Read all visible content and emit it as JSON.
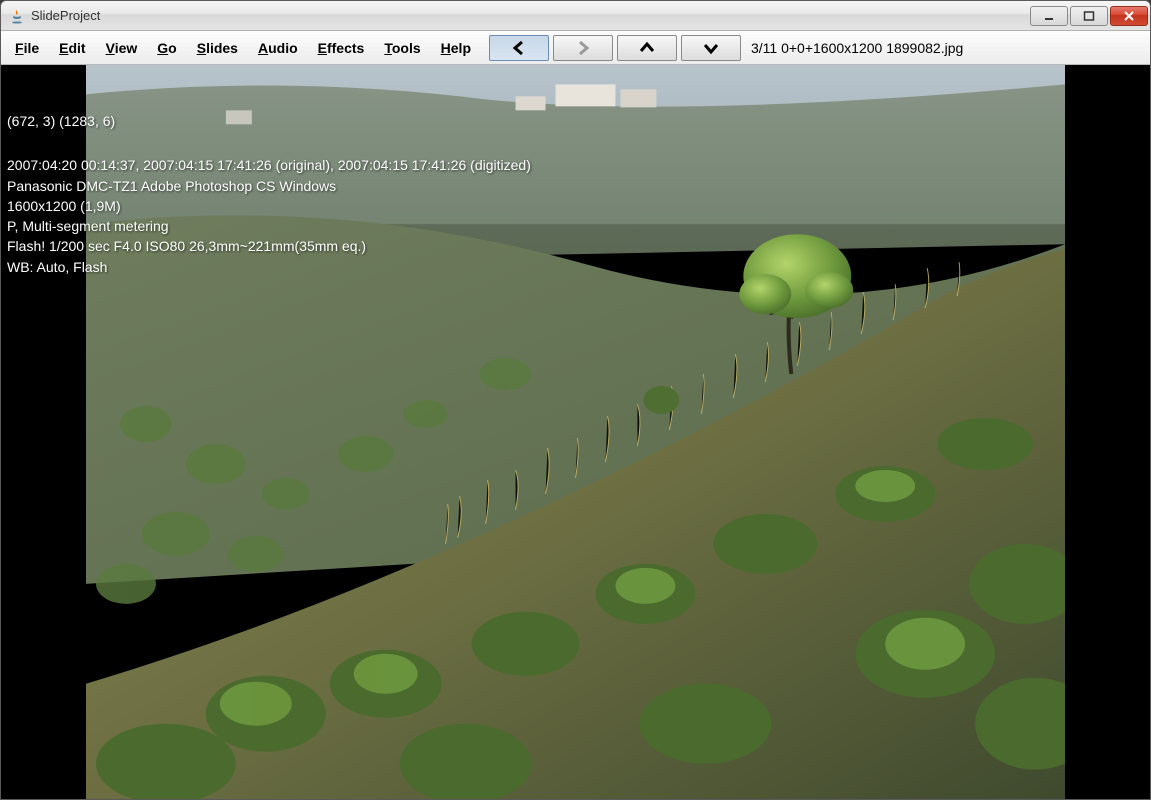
{
  "window": {
    "title": "SlideProject"
  },
  "menu": {
    "items": [
      {
        "label": "File",
        "ul": "F"
      },
      {
        "label": "Edit",
        "ul": "E"
      },
      {
        "label": "View",
        "ul": "V"
      },
      {
        "label": "Go",
        "ul": "G"
      },
      {
        "label": "Slides",
        "ul": "S"
      },
      {
        "label": "Audio",
        "ul": "A"
      },
      {
        "label": "Effects",
        "ul": "E"
      },
      {
        "label": "Tools",
        "ul": "T"
      },
      {
        "label": "Help",
        "ul": "H"
      }
    ]
  },
  "toolbar": {
    "status": "3/11  0+0+1600x1200  1899082.jpg"
  },
  "overlay": {
    "coords": "(672, 3) (1283, 6)",
    "line1": "2007:04:20 00:14:37, 2007:04:15 17:41:26 (original), 2007:04:15 17:41:26 (digitized)",
    "line2": "Panasonic DMC-TZ1  Adobe Photoshop CS Windows",
    "line3": "1600x1200 (1,9M)",
    "line4": "P, Multi-segment metering",
    "line5": "Flash! 1/200 sec  F4.0  ISO80  26,3mm~221mm(35mm eq.)",
    "line6": "WB: Auto, Flash"
  }
}
